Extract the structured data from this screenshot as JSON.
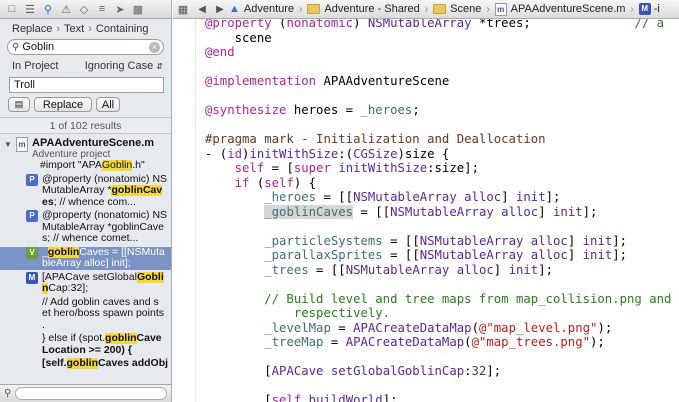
{
  "navigator": {
    "breadcrumb": [
      "Replace",
      "Text",
      "Containing"
    ],
    "search_value": "Goblin",
    "scope_left": "In Project",
    "scope_right": "Ignoring Case",
    "replace_value": "Troll",
    "replace_button": "Replace",
    "all_button": "All",
    "result_count": "1 of 102 results",
    "file_name": "APAAdventureScene.m",
    "project_name": "Adventure project",
    "results": [
      {
        "badge": "",
        "l1a": "#import \"APA",
        "l1h": "Goblin",
        "l1b": ".h\""
      },
      {
        "badge": "P",
        "l1": "@property (nonatomic) NS",
        "l2a": "MutableArray *",
        "l2h": "goblinCav",
        "l2b": "",
        "l3a": "es",
        "l3b": ";      // whence com..."
      },
      {
        "badge": "P",
        "l1": "@property (nonatomic) NS",
        "l2": "MutableArray *goblinCave",
        "l3": "s;     // whence comet..."
      },
      {
        "badge": "V",
        "l1a": "_",
        "l1h": "goblin",
        "l1b": "Caves = [[NSMuta",
        "l2": "bleArray alloc] init];"
      },
      {
        "badge": "M",
        "l1a": "[APACave setGlobal",
        "l1h": "Gobli",
        "l2a": "n",
        "l2b": "Cap:32];"
      },
      {
        "badge": "",
        "l1": "// Add goblin caves and s",
        "l2": "et hero/boss spawn points",
        "l3": "."
      },
      {
        "badge": "",
        "l1a": "} else if (spot.",
        "l1h": "goblin",
        "l1b": "Cave",
        "l2": "Location >= 200) {"
      },
      {
        "badge": "",
        "l1a": "[self.",
        "l1h": "goblin",
        "l1b": "Caves addObj"
      }
    ]
  },
  "jumpbar": {
    "crumbs": [
      "Adventure",
      "Adventure - Shared",
      "Scene",
      "APAAdventureScene.m",
      "-i"
    ]
  },
  "code_lines": [
    "@property (nonatomic) NSMutableArray *trees;              // a",
    "    scene",
    "@end",
    "",
    "@implementation APAAdventureScene",
    "",
    "@synthesize heroes = _heroes;",
    "",
    "#pragma mark - Initialization and Deallocation",
    "- (id)initWithSize:(CGSize)size {",
    "    self = [super initWithSize:size];",
    "    if (self) {",
    "        _heroes = [[NSMutableArray alloc] init];",
    "        _goblinCaves = [[NSMutableArray alloc] init];",
    "",
    "        _particleSystems = [[NSMutableArray alloc] init];",
    "        _parallaxSprites = [[NSMutableArray alloc] init];",
    "        _trees = [[NSMutableArray alloc] init];",
    "",
    "        // Build level and tree maps from map_collision.png and",
    "            respectively.",
    "        _levelMap = APACreateDataMap(@\"map_level.png\");",
    "        _treeMap = APACreateDataMap(@\"map_trees.png\");",
    "",
    "        [APACave setGlobalGoblinCap:32];",
    "",
    "        [self buildWorld];"
  ]
}
